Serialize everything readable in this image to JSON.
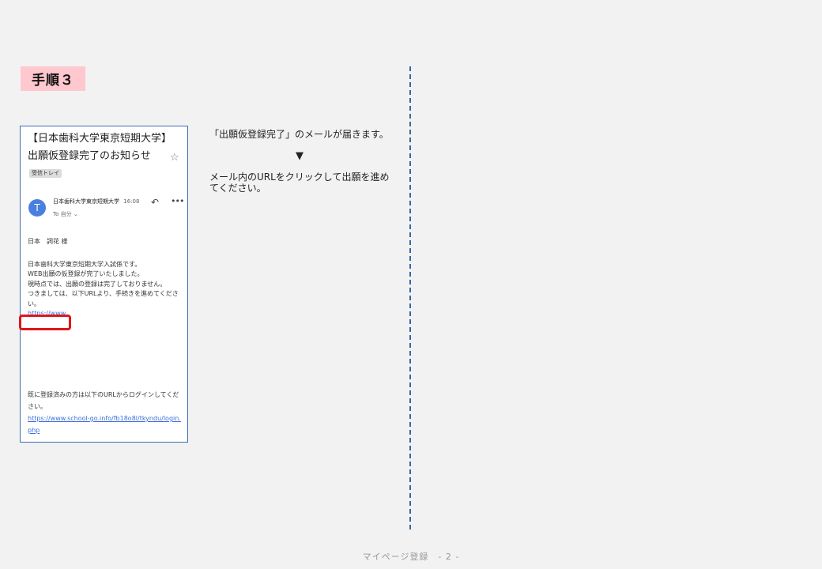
{
  "step": {
    "label": "手順３"
  },
  "mail": {
    "subject": "【日本歯科大学東京短期大学】出願仮登録完了のお知らせ",
    "inbox_tag": "受信トレイ",
    "avatar_letter": "T",
    "sender": "日本歯科大学東京短期大学",
    "time": "16:08",
    "recipient": "To 自分 ⌄",
    "greeting": "日本　詞花 様",
    "body_lines": [
      "日本歯科大学東京短期大学入試係です。",
      "WEB出願の仮登録が完了いたしました。",
      "現時点では、出願の登録は完了しておりません。",
      "つきましては、以下URLより、手続きを進めてください。"
    ],
    "link_text": "https://www",
    "footer_text": "既に登録済みの方は以下のURLからログインしてください。",
    "footer_link": "https://www.school-go.info/fb18o8l/tkyndu/login.php"
  },
  "instructions": {
    "line1": "「出願仮登録完了」のメールが届きます。",
    "arrow": "▼",
    "line2": "メール内のURLをクリックして出願を進めてください。"
  },
  "footer": {
    "page_label": "マイページ登録　- 2 -"
  },
  "colors": {
    "highlight": "#e0151b",
    "badge": "#ffc7ce",
    "divider": "#2f6aa0",
    "link": "#3b6fd8"
  }
}
